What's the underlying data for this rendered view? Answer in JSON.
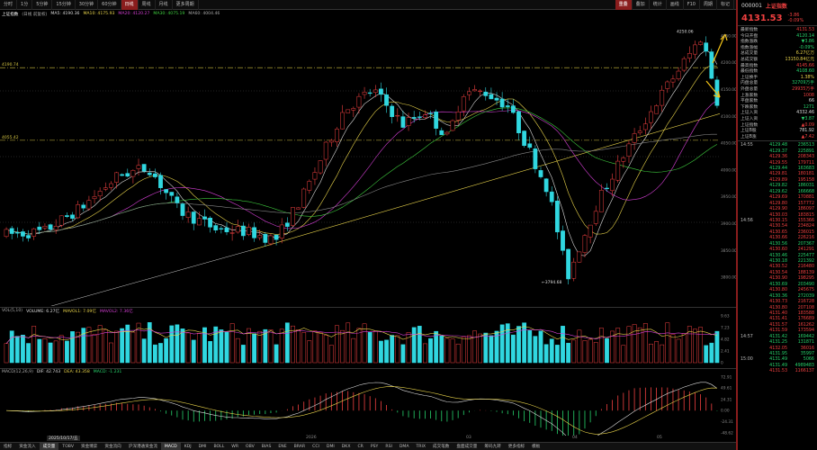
{
  "toolbar": {
    "items": [
      {
        "label": "分时",
        "active": false
      },
      {
        "label": "1分",
        "active": false
      },
      {
        "label": "5分钟",
        "active": false
      },
      {
        "label": "15分钟",
        "active": false
      },
      {
        "label": "30分钟",
        "active": false
      },
      {
        "label": "60分钟",
        "active": false
      },
      {
        "label": "日线",
        "active": true
      },
      {
        "label": "周线",
        "active": false
      },
      {
        "label": "月线",
        "active": false
      },
      {
        "label": "更多周期",
        "active": false
      }
    ],
    "right_items": [
      {
        "label": "重叠",
        "active": true
      },
      {
        "label": "叠加",
        "active": false
      },
      {
        "label": "统计",
        "active": false
      },
      {
        "label": "画线",
        "active": false
      },
      {
        "label": "F10",
        "active": false
      },
      {
        "label": "周期",
        "active": false
      },
      {
        "label": "标记",
        "active": false
      }
    ]
  },
  "main_legend": {
    "title": "上证指数",
    "entries": [
      {
        "text": "(日线 前复权)",
        "color": "#aaaaaa"
      },
      {
        "text": "MA5: 4190.36",
        "color": "#dddddd"
      },
      {
        "text": "MA10: 4175.93",
        "color": "#e8d34a"
      },
      {
        "text": "MA20: 4120.27",
        "color": "#d53fd5"
      },
      {
        "text": "MA30: 4075.19",
        "color": "#3fcf3f"
      },
      {
        "text": "MA60: 4004.46",
        "color": "#aaaaaa"
      }
    ],
    "setting": "设置均线"
  },
  "kline": {
    "high_marker": "4250.06",
    "low_marker": "3794.68",
    "line_label_top": "4190.74",
    "line_label_mid": "4055.42",
    "price_axis": [
      "4250.00",
      "4200.00",
      "4150.00",
      "4100.00",
      "4050.00",
      "4000.00",
      "3950.00",
      "3900.00",
      "3850.00",
      "3800.00"
    ]
  },
  "volume_legend": {
    "title": "VOL(5,10)",
    "entries": [
      {
        "text": "VOLUME: 6.27亿",
        "color": "#dddddd"
      },
      {
        "text": "MAVOL1: 7.09亿",
        "color": "#e8d34a"
      },
      {
        "text": "MAVOL2: 7.36亿",
        "color": "#d53fd5"
      }
    ],
    "right": [
      "放复原",
      "指标",
      "换指标"
    ],
    "axis": [
      "9.63",
      "7.23",
      "4.82",
      "2.41",
      "0"
    ]
  },
  "macd_legend": {
    "title": "MACD(12,26,9)",
    "entries": [
      {
        "text": "DIF: 42.743",
        "color": "#dddddd"
      },
      {
        "text": "DEA: 43.358",
        "color": "#e8d34a"
      },
      {
        "text": "MACD: -1.231",
        "color": "#27d36c"
      }
    ],
    "right": [
      "放复原",
      "指标",
      "换指标"
    ],
    "axis": [
      "72.91",
      "49.61",
      "24.31",
      "0.00",
      "-24.31",
      "-48.62"
    ]
  },
  "date_axis": {
    "date_box": "2025/10/17/五",
    "labels": [
      "2026",
      "03",
      "04",
      "05"
    ]
  },
  "bottom_tabs": [
    {
      "label": "指标",
      "active": false
    },
    {
      "label": "资金流入",
      "active": false
    },
    {
      "label": "成交量",
      "active": true
    },
    {
      "label": "TOBV",
      "active": false
    },
    {
      "label": "资金博弈",
      "active": false
    },
    {
      "label": "资金流向",
      "active": false
    },
    {
      "label": "沪深港通资金流",
      "active": false
    },
    {
      "label": "MACD",
      "active": true
    },
    {
      "label": "KDJ",
      "active": false
    },
    {
      "label": "DMI",
      "active": false
    },
    {
      "label": "BOLL",
      "active": false
    },
    {
      "label": "WR",
      "active": false
    },
    {
      "label": "OBV",
      "active": false
    },
    {
      "label": "BIAS",
      "active": false
    },
    {
      "label": "ENE",
      "active": false
    },
    {
      "label": "BRAR",
      "active": false
    },
    {
      "label": "CCI",
      "active": false
    },
    {
      "label": "DMI",
      "active": false
    },
    {
      "label": "DKX",
      "active": false
    },
    {
      "label": "CR",
      "active": false
    },
    {
      "label": "PSY",
      "active": false
    },
    {
      "label": "RSI",
      "active": false
    },
    {
      "label": "DMA",
      "active": false
    },
    {
      "label": "TRIX",
      "active": false
    },
    {
      "label": "成交笔数",
      "active": false
    },
    {
      "label": "盘面成交量",
      "active": false
    },
    {
      "label": "筹码九转",
      "active": false
    },
    {
      "label": "更多指标",
      "active": false
    },
    {
      "label": "模板",
      "active": false
    }
  ],
  "sidebar": {
    "code": "000001",
    "name": "上证指数",
    "price": "4131.53",
    "change": "-3.86",
    "change_pct": "-0.09%",
    "stats": [
      {
        "label": "最新指数",
        "value": "4131.53",
        "color": "#f04040"
      },
      {
        "label": "今日开盘",
        "value": "4120.14",
        "color": "#27d36c"
      },
      {
        "label": "指数涨跌",
        "value": "▼3.86",
        "color": "#27d36c"
      },
      {
        "label": "指数涨幅",
        "value": "-0.09%",
        "color": "#27d36c"
      },
      {
        "label": "总成交量",
        "value": "6.27亿万",
        "color": "#e8d34a"
      },
      {
        "label": "总成交额",
        "value": "13150.84亿元",
        "color": "#e8d34a"
      },
      {
        "label": "最高指数",
        "value": "4145.66",
        "color": "#f04040"
      },
      {
        "label": "最低指数",
        "value": "4108.60",
        "color": "#27d36c"
      },
      {
        "label": "上证换手",
        "value": "1.38%",
        "color": "#e8d34a"
      },
      {
        "label": "内盘总量",
        "value": "32709万手",
        "color": "#27d36c"
      },
      {
        "label": "外盘总量",
        "value": "29935万手",
        "color": "#f04040"
      },
      {
        "label": "上涨家数",
        "value": "1008",
        "color": "#f04040"
      },
      {
        "label": "平盘家数",
        "value": "66",
        "color": "#dddddd"
      },
      {
        "label": "下跌家数",
        "value": "1271",
        "color": "#27d36c"
      },
      {
        "label": "上证入资",
        "value": "4332.46",
        "color": "#dddddd"
      },
      {
        "label": "上证入资",
        "value": "▼3.87",
        "color": "#27d36c"
      },
      {
        "label": "上证指数",
        "value": "▲0.09",
        "color": "#f04040"
      },
      {
        "label": "上证B股",
        "value": "781.92",
        "color": "#dddddd"
      },
      {
        "label": "上证B涨",
        "value": "▲7.42",
        "color": "#f04040"
      }
    ],
    "ticks": [
      {
        "time": "14:55",
        "price": "4129.48",
        "vol": "236513",
        "dir": "down"
      },
      {
        "time": "",
        "price": "4129.37",
        "vol": "225891",
        "dir": "down"
      },
      {
        "time": "",
        "price": "4129.36",
        "vol": "208343",
        "dir": "up"
      },
      {
        "time": "",
        "price": "4129.55",
        "vol": "179711",
        "dir": "up"
      },
      {
        "time": "",
        "price": "4129.44",
        "vol": "163683",
        "dir": "down"
      },
      {
        "time": "",
        "price": "4129.81",
        "vol": "180181",
        "dir": "up"
      },
      {
        "time": "",
        "price": "4129.89",
        "vol": "195158",
        "dir": "up"
      },
      {
        "time": "",
        "price": "4129.82",
        "vol": "186031",
        "dir": "down"
      },
      {
        "time": "",
        "price": "4129.62",
        "vol": "166668",
        "dir": "down"
      },
      {
        "time": "",
        "price": "4129.69",
        "vol": "170881",
        "dir": "up"
      },
      {
        "time": "",
        "price": "4129.80",
        "vol": "157772",
        "dir": "up"
      },
      {
        "time": "",
        "price": "4129.90",
        "vol": "186097",
        "dir": "up"
      },
      {
        "time": "",
        "price": "4130.03",
        "vol": "183815",
        "dir": "up"
      },
      {
        "time": "14:56",
        "price": "4130.15",
        "vol": "155366",
        "dir": "up"
      },
      {
        "time": "",
        "price": "4130.54",
        "vol": "234824",
        "dir": "up"
      },
      {
        "time": "",
        "price": "4130.65",
        "vol": "236015",
        "dir": "up"
      },
      {
        "time": "",
        "price": "4130.66",
        "vol": "226216",
        "dir": "up"
      },
      {
        "time": "",
        "price": "4130.56",
        "vol": "207367",
        "dir": "down"
      },
      {
        "time": "",
        "price": "4130.60",
        "vol": "241291",
        "dir": "up"
      },
      {
        "time": "",
        "price": "4130.46",
        "vol": "225477",
        "dir": "down"
      },
      {
        "time": "",
        "price": "4130.18",
        "vol": "221392",
        "dir": "down"
      },
      {
        "time": "",
        "price": "4130.52",
        "vol": "216480",
        "dir": "up"
      },
      {
        "time": "",
        "price": "4130.54",
        "vol": "188139",
        "dir": "up"
      },
      {
        "time": "",
        "price": "4130.90",
        "vol": "198295",
        "dir": "up"
      },
      {
        "time": "",
        "price": "4130.69",
        "vol": "203490",
        "dir": "down"
      },
      {
        "time": "",
        "price": "4130.80",
        "vol": "245675",
        "dir": "up"
      },
      {
        "time": "",
        "price": "4130.36",
        "vol": "272039",
        "dir": "down"
      },
      {
        "time": "",
        "price": "4130.73",
        "vol": "216728",
        "dir": "up"
      },
      {
        "time": "",
        "price": "4130.80",
        "vol": "207108",
        "dir": "up"
      },
      {
        "time": "",
        "price": "4131.40",
        "vol": "183588",
        "dir": "up"
      },
      {
        "time": "",
        "price": "4131.41",
        "vol": "176689",
        "dir": "up"
      },
      {
        "time": "",
        "price": "4131.57",
        "vol": "161262",
        "dir": "up"
      },
      {
        "time": "",
        "price": "4131.59",
        "vol": "173594",
        "dir": "up"
      },
      {
        "time": "14:57",
        "price": "4131.42",
        "vol": "169442",
        "dir": "down"
      },
      {
        "time": "",
        "price": "4131.25",
        "vol": "131871",
        "dir": "down"
      },
      {
        "time": "",
        "price": "4132.05",
        "vol": "36016",
        "dir": "up"
      },
      {
        "time": "",
        "price": "4131.95",
        "vol": "35997",
        "dir": "down"
      },
      {
        "time": "15:00",
        "price": "4131.49",
        "vol": "5066",
        "dir": "down"
      },
      {
        "time": "",
        "price": "4131.49",
        "vol": "4989483",
        "dir": "down"
      },
      {
        "time": "",
        "price": "4131.53",
        "vol": "1166137",
        "dir": "up"
      }
    ]
  },
  "colors": {
    "up": "#f04040",
    "down": "#30d7e0",
    "accent": "#8a1d1d"
  },
  "icons": [
    "up-arrow-icon",
    "down-arrow-icon"
  ]
}
